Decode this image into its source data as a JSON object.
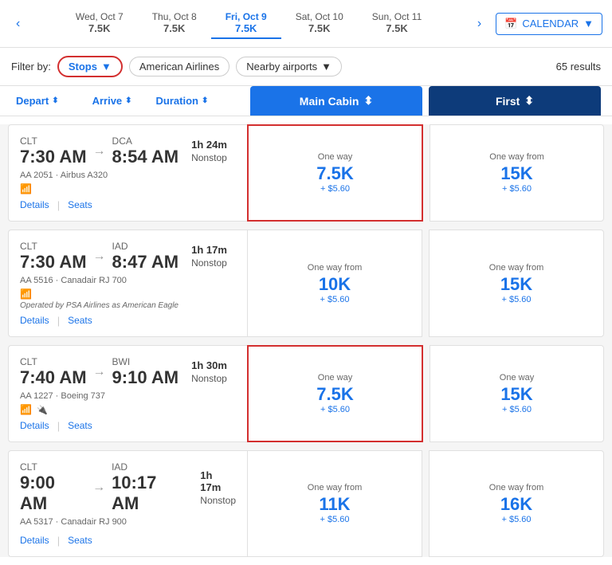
{
  "dateStrip": {
    "prevArrow": "‹",
    "nextArrow": "›",
    "dates": [
      {
        "label": "Wed, Oct 7",
        "points": "7.5K",
        "active": false
      },
      {
        "label": "Thu, Oct 8",
        "points": "7.5K",
        "active": false
      },
      {
        "label": "Fri, Oct 9",
        "points": "7.5K",
        "active": true
      },
      {
        "label": "Sat, Oct 10",
        "points": "7.5K",
        "active": false
      },
      {
        "label": "Sun, Oct 11",
        "points": "7.5K",
        "active": false
      }
    ],
    "calendarLabel": "CALENDAR"
  },
  "filterRow": {
    "filterByLabel": "Filter by:",
    "stopsLabel": "Stops",
    "airlineLabel": "American Airlines",
    "nearbyLabel": "Nearby airports",
    "resultsCount": "65 results"
  },
  "colHeaders": {
    "depart": "Depart",
    "arrive": "Arrive",
    "duration": "Duration",
    "mainCabin": "Main Cabin",
    "first": "First"
  },
  "flights": [
    {
      "depart": "7:30 AM",
      "departAirport": "CLT",
      "arrive": "8:54 AM",
      "arriveAirport": "DCA",
      "duration": "1h 24m",
      "stops": "Nonstop",
      "flightNum": "AA 2051",
      "aircraft": "Airbus A320",
      "hasWifi": true,
      "details": "Details",
      "seats": "Seats",
      "mainCabinLabel": "One way",
      "mainCabinPoints": "7.5K",
      "mainCabinFee": "+ $5.60",
      "mainHighlighted": true,
      "firstLabel": "One way from",
      "firstPoints": "15K",
      "firstFee": "+ $5.60",
      "firstHighlighted": false,
      "poweredBy": ""
    },
    {
      "depart": "7:30 AM",
      "departAirport": "CLT",
      "arrive": "8:47 AM",
      "arriveAirport": "IAD",
      "duration": "1h 17m",
      "stops": "Nonstop",
      "flightNum": "AA 5516",
      "aircraft": "Canadair RJ 700",
      "hasWifi": true,
      "details": "Details",
      "seats": "Seats",
      "mainCabinLabel": "One way from",
      "mainCabinPoints": "10K",
      "mainCabinFee": "+ $5.60",
      "mainHighlighted": false,
      "firstLabel": "One way from",
      "firstPoints": "15K",
      "firstFee": "+ $5.60",
      "firstHighlighted": false,
      "poweredBy": "Operated by PSA Airlines as American Eagle"
    },
    {
      "depart": "7:40 AM",
      "departAirport": "CLT",
      "arrive": "9:10 AM",
      "arriveAirport": "BWI",
      "duration": "1h 30m",
      "stops": "Nonstop",
      "flightNum": "AA 1227",
      "aircraft": "Boeing 737",
      "hasWifi": true,
      "hasPlug": true,
      "details": "Details",
      "seats": "Seats",
      "mainCabinLabel": "One way",
      "mainCabinPoints": "7.5K",
      "mainCabinFee": "+ $5.60",
      "mainHighlighted": true,
      "firstLabel": "One way",
      "firstPoints": "15K",
      "firstFee": "+ $5.60",
      "firstHighlighted": false,
      "poweredBy": ""
    },
    {
      "depart": "9:00 AM",
      "departAirport": "CLT",
      "arrive": "10:17 AM",
      "arriveAirport": "IAD",
      "duration": "1h 17m",
      "stops": "Nonstop",
      "flightNum": "AA 5317",
      "aircraft": "Canadair RJ 900",
      "hasWifi": false,
      "details": "Details",
      "seats": "Seats",
      "mainCabinLabel": "One way from",
      "mainCabinPoints": "11K",
      "mainCabinFee": "+ $5.60",
      "mainHighlighted": false,
      "firstLabel": "One way from",
      "firstPoints": "16K",
      "firstFee": "+ $5.60",
      "firstHighlighted": false,
      "poweredBy": ""
    }
  ]
}
